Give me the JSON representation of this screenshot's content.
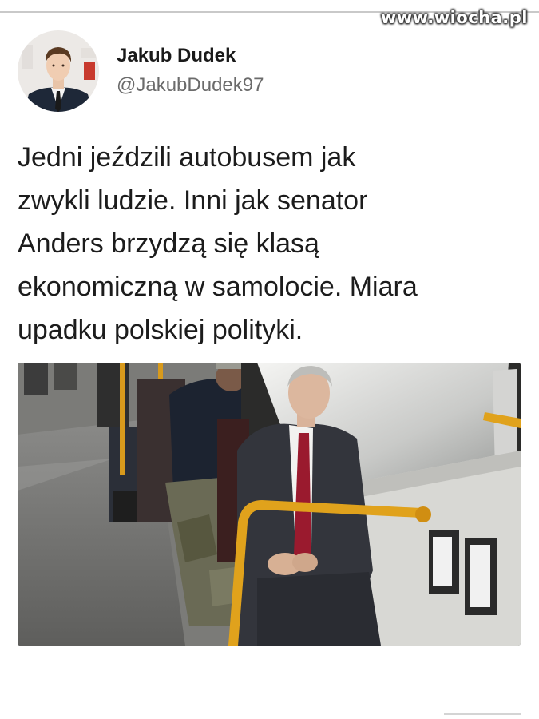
{
  "watermark": {
    "text": "www.wiocha.pl"
  },
  "author": {
    "display_name": "Jakub Dudek",
    "handle": "@JakubDudek97"
  },
  "tweet": {
    "lines": [
      "Jedni jeździli autobusem jak",
      "zwykli ludzie. Inni jak senator",
      "Anders brzydzą się klasą",
      "ekonomiczną w samolocie. Miara",
      "upadku polskiej polityki."
    ]
  },
  "colors": {
    "text": "#1c1c1c",
    "handle": "#6b6b6b",
    "handrail": "#e0a21c"
  },
  "icons": [
    "avatar-photo",
    "bus-interior-photo"
  ]
}
